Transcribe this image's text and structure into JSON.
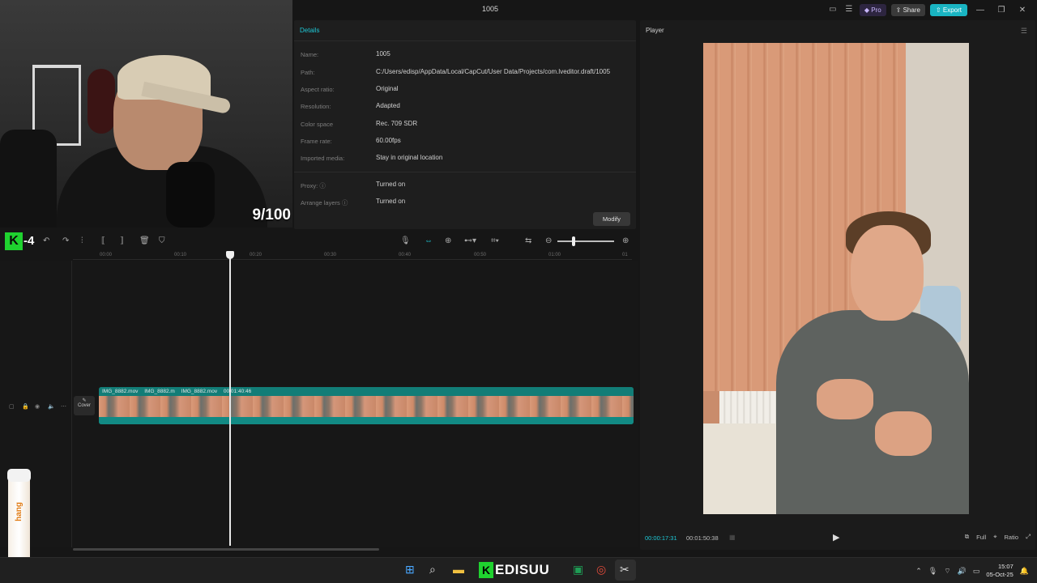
{
  "webcam": {
    "counter": "9/100"
  },
  "app": {
    "title": "1005",
    "toolbar": {
      "pro": "Pro",
      "share": "Share",
      "export": "Export"
    }
  },
  "details": {
    "header": "Details",
    "rows": [
      {
        "label": "Name:",
        "value": "1005"
      },
      {
        "label": "Path:",
        "value": "C:/Users/edisp/AppData/Local/CapCut/User Data/Projects/com.lveditor.draft/1005"
      },
      {
        "label": "Aspect ratio:",
        "value": "Original"
      },
      {
        "label": "Resolution:",
        "value": "Adapted"
      },
      {
        "label": "Color space",
        "value": "Rec. 709 SDR"
      },
      {
        "label": "Frame rate:",
        "value": "60.00fps"
      },
      {
        "label": "Imported media:",
        "value": "Stay in original location"
      },
      {
        "label": "Proxy:",
        "value": "Turned on"
      },
      {
        "label": "Arrange layers",
        "value": "Turned on"
      }
    ],
    "modify": "Modify"
  },
  "player": {
    "header": "Player",
    "current_time": "00:00:17:31",
    "total_time": "00:01:50:38",
    "full": "Full",
    "ratio": "Ratio"
  },
  "timeline": {
    "logo_letter": "K",
    "logo_num": "4",
    "ruler": [
      "00:00",
      "00:10",
      "00:20",
      "00:30",
      "00:40",
      "00:50",
      "01:00",
      "01"
    ],
    "cover": "Cover",
    "clip_names": [
      "IMG_8882.mov",
      "IMG_8882.m",
      "IMG_8882.mov",
      "00:01:40:46"
    ]
  },
  "taskbar": {
    "brand": "EDISUU",
    "brand_k": "K",
    "time": "15:07",
    "date": "05-Oct-25"
  },
  "tube": {
    "label": "hang"
  },
  "colors": {
    "accent": "#1ec8d6",
    "brand_green": "#1fd22f",
    "export": "#19b4c2"
  }
}
